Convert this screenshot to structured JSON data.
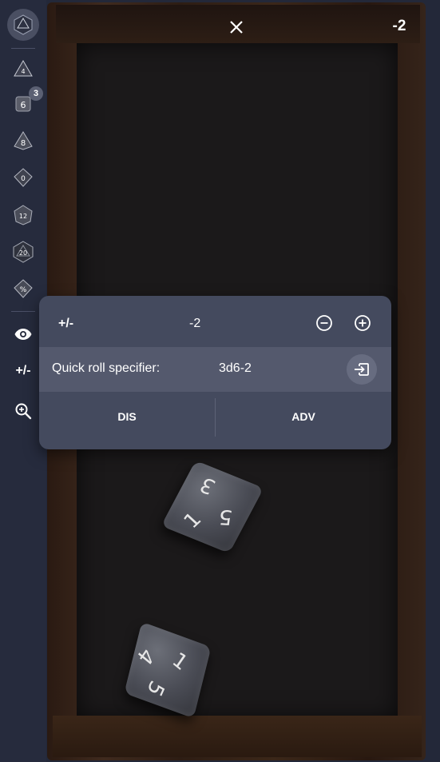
{
  "header": {
    "close_icon": "close-icon",
    "total": "-2"
  },
  "sidebar": {
    "logo": {
      "icon": "d20-logo-icon",
      "label": "20"
    },
    "dice": [
      {
        "name": "d4",
        "label": "4"
      },
      {
        "name": "d6",
        "label": "6",
        "badge": "3"
      },
      {
        "name": "d8",
        "label": "8"
      },
      {
        "name": "d10",
        "label": "0"
      },
      {
        "name": "d12",
        "label": "12"
      },
      {
        "name": "d20",
        "label": "20"
      },
      {
        "name": "d100",
        "label": "%"
      }
    ],
    "tools": [
      {
        "name": "visibility",
        "icon": "eye-icon"
      },
      {
        "name": "modifier",
        "label": "+/-"
      },
      {
        "name": "zoom",
        "icon": "zoom-icon"
      }
    ]
  },
  "panel": {
    "modifier_label": "+/-",
    "modifier_value": "-2",
    "decrement_icon": "minus-circle-icon",
    "increment_icon": "plus-circle-icon",
    "quick_roll_label": "Quick roll specifier:",
    "quick_roll_value": "3d6-2",
    "submit_icon": "input-icon",
    "dis_label": "DIS",
    "adv_label": "ADV"
  },
  "dice_on_tray": [
    {
      "faces": [
        "3",
        "5",
        "1"
      ]
    },
    {
      "faces": [
        "1",
        "4",
        "5"
      ]
    }
  ],
  "colors": {
    "sidebar_bg": "#262b3d",
    "panel_bg": "#444a5e",
    "panel_highlight": "#54596d",
    "tray_floor": "#1b191a"
  }
}
